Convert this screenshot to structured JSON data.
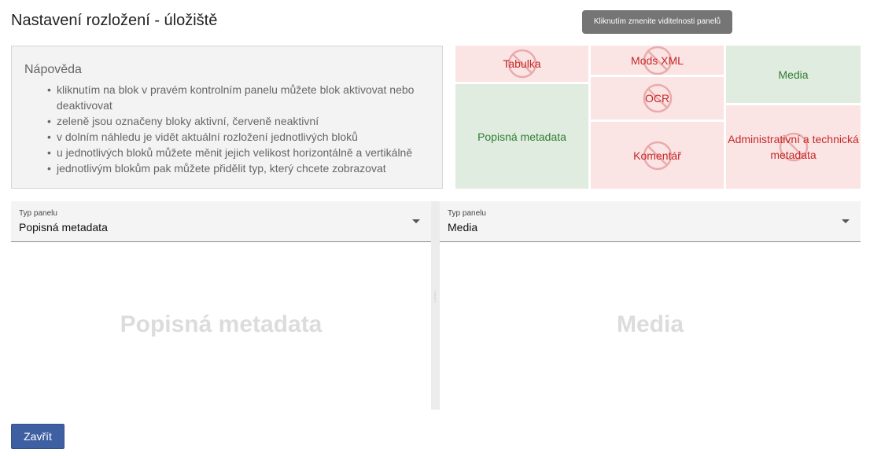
{
  "page": {
    "title": "Nastavení rozložení - úložiště"
  },
  "tooltip": {
    "text": "Kliknutím zmenite viditelnosti panelů"
  },
  "help": {
    "title": "Nápověda",
    "items": [
      "kliknutím na blok v pravém kontrolním panelu můžete blok aktivovat nebo deaktivovat",
      "zeleně jsou označeny bloky aktivní, červeně neaktivní",
      "v dolním náhledu je vidět aktuální rozložení jednotlivých bloků",
      "u jednotlivých bloků můžete měnit jejich velikost horizontálně a vertikálně",
      "jednotlivým blokům pak můžete přidělit typ, který chcete zobrazovat"
    ]
  },
  "layout_blocks": {
    "tabulka": {
      "label": "Tabulka",
      "state": "inactive"
    },
    "mods_xml": {
      "label": "Mods XML",
      "state": "inactive"
    },
    "media": {
      "label": "Media",
      "state": "active"
    },
    "ocr": {
      "label": "OCR",
      "state": "inactive"
    },
    "popisna": {
      "label": "Popisná metadata",
      "state": "active"
    },
    "komentar": {
      "label": "Komentář",
      "state": "inactive"
    },
    "admin": {
      "label": "Administrativní a technická metadata",
      "state": "inactive"
    }
  },
  "panels": {
    "left": {
      "select_label": "Typ panelu",
      "select_value": "Popisná metadata",
      "preview": "Popisná metadata"
    },
    "right": {
      "select_label": "Typ panelu",
      "select_value": "Media",
      "preview": "Media"
    }
  },
  "footer": {
    "close_label": "Zavřít"
  },
  "colors": {
    "active_bg": "#e1ece0",
    "active_text": "#2e7d32",
    "inactive_bg": "#fbe4e4",
    "inactive_text": "#c62828",
    "primary_button": "#3f5fa3"
  }
}
